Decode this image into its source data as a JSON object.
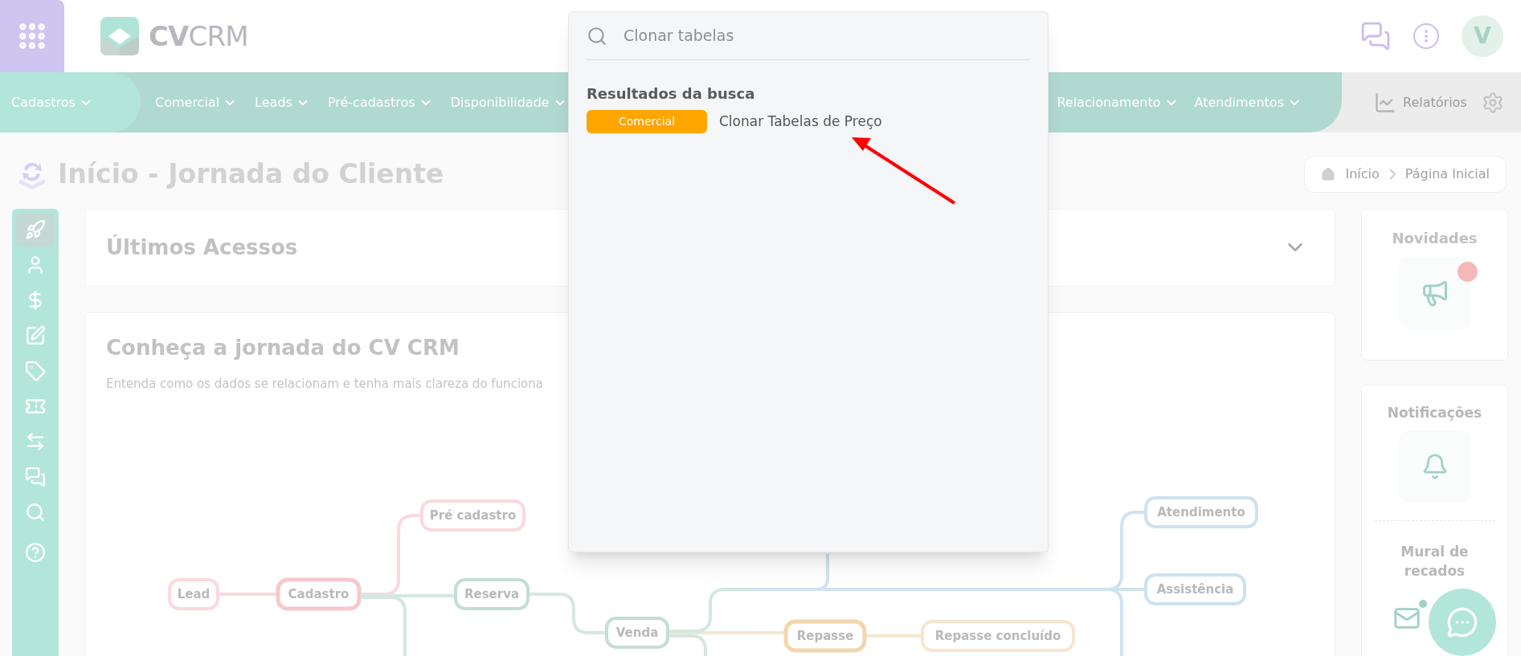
{
  "header": {
    "logo": "**CV**CRM",
    "avatar": "V"
  },
  "nav": {
    "items": [
      {
        "label": "Cadastros",
        "selected": true
      },
      {
        "label": "Comercial",
        "selected": false
      },
      {
        "label": "Leads",
        "selected": false
      },
      {
        "label": "Pré-cadastros",
        "selected": false
      },
      {
        "label": "Disponibilidade",
        "selected": false
      },
      {
        "label": "Relacionamento",
        "selected": false
      },
      {
        "label": "Atendimentos",
        "selected": false
      }
    ],
    "reports": "Relatórios"
  },
  "page_title": "Início - Jornada do Cliente",
  "breadcrumb": [
    "Início",
    "Página Inicial"
  ],
  "sidebar": {
    "items": [
      {
        "selected": true
      },
      {
        "selected": false
      },
      {
        "selected": false
      },
      {
        "selected": false
      },
      {
        "selected": false
      },
      {
        "selected": false
      },
      {
        "selected": false
      },
      {
        "selected": false
      },
      {
        "selected": false
      },
      {
        "selected": false
      }
    ]
  },
  "recent": {
    "title": "Últimos Acessos"
  },
  "journey": {
    "title": "Conheça a jornada do CV CRM",
    "subtitle": "Entenda como os dados se relacionam e tenha mais clareza do funciona",
    "nodes": [
      {
        "label": "Lead",
        "color": "#fbd9dc"
      },
      {
        "label": "Cadastro",
        "color": "#f8c8cb"
      },
      {
        "label": "Pré cadastro",
        "color": "#fbd9dc"
      },
      {
        "label": "Reserva",
        "color": "#c4ddd6"
      },
      {
        "label": "Venda",
        "color": "#c4ddd6"
      },
      {
        "label": "Repasse",
        "color": "#f3d6ac"
      },
      {
        "label": "Repasse concluído",
        "color": "#f8e6d0"
      },
      {
        "label": "Atendimento",
        "color": "#cde2f0"
      },
      {
        "label": "Assistência",
        "color": "#cde2f0"
      }
    ]
  },
  "side_panels": [
    {
      "title": "Novidades",
      "has_new": true
    },
    {
      "title": "Notificações",
      "has_new": false
    },
    {
      "title": "Mural de recados",
      "has_new": true
    }
  ],
  "search": {
    "value": "Clonar tabelas",
    "section": "Resultados da busca",
    "results": [
      {
        "category": "Comercial",
        "title": "Clonar Tabelas de Preço"
      }
    ]
  }
}
